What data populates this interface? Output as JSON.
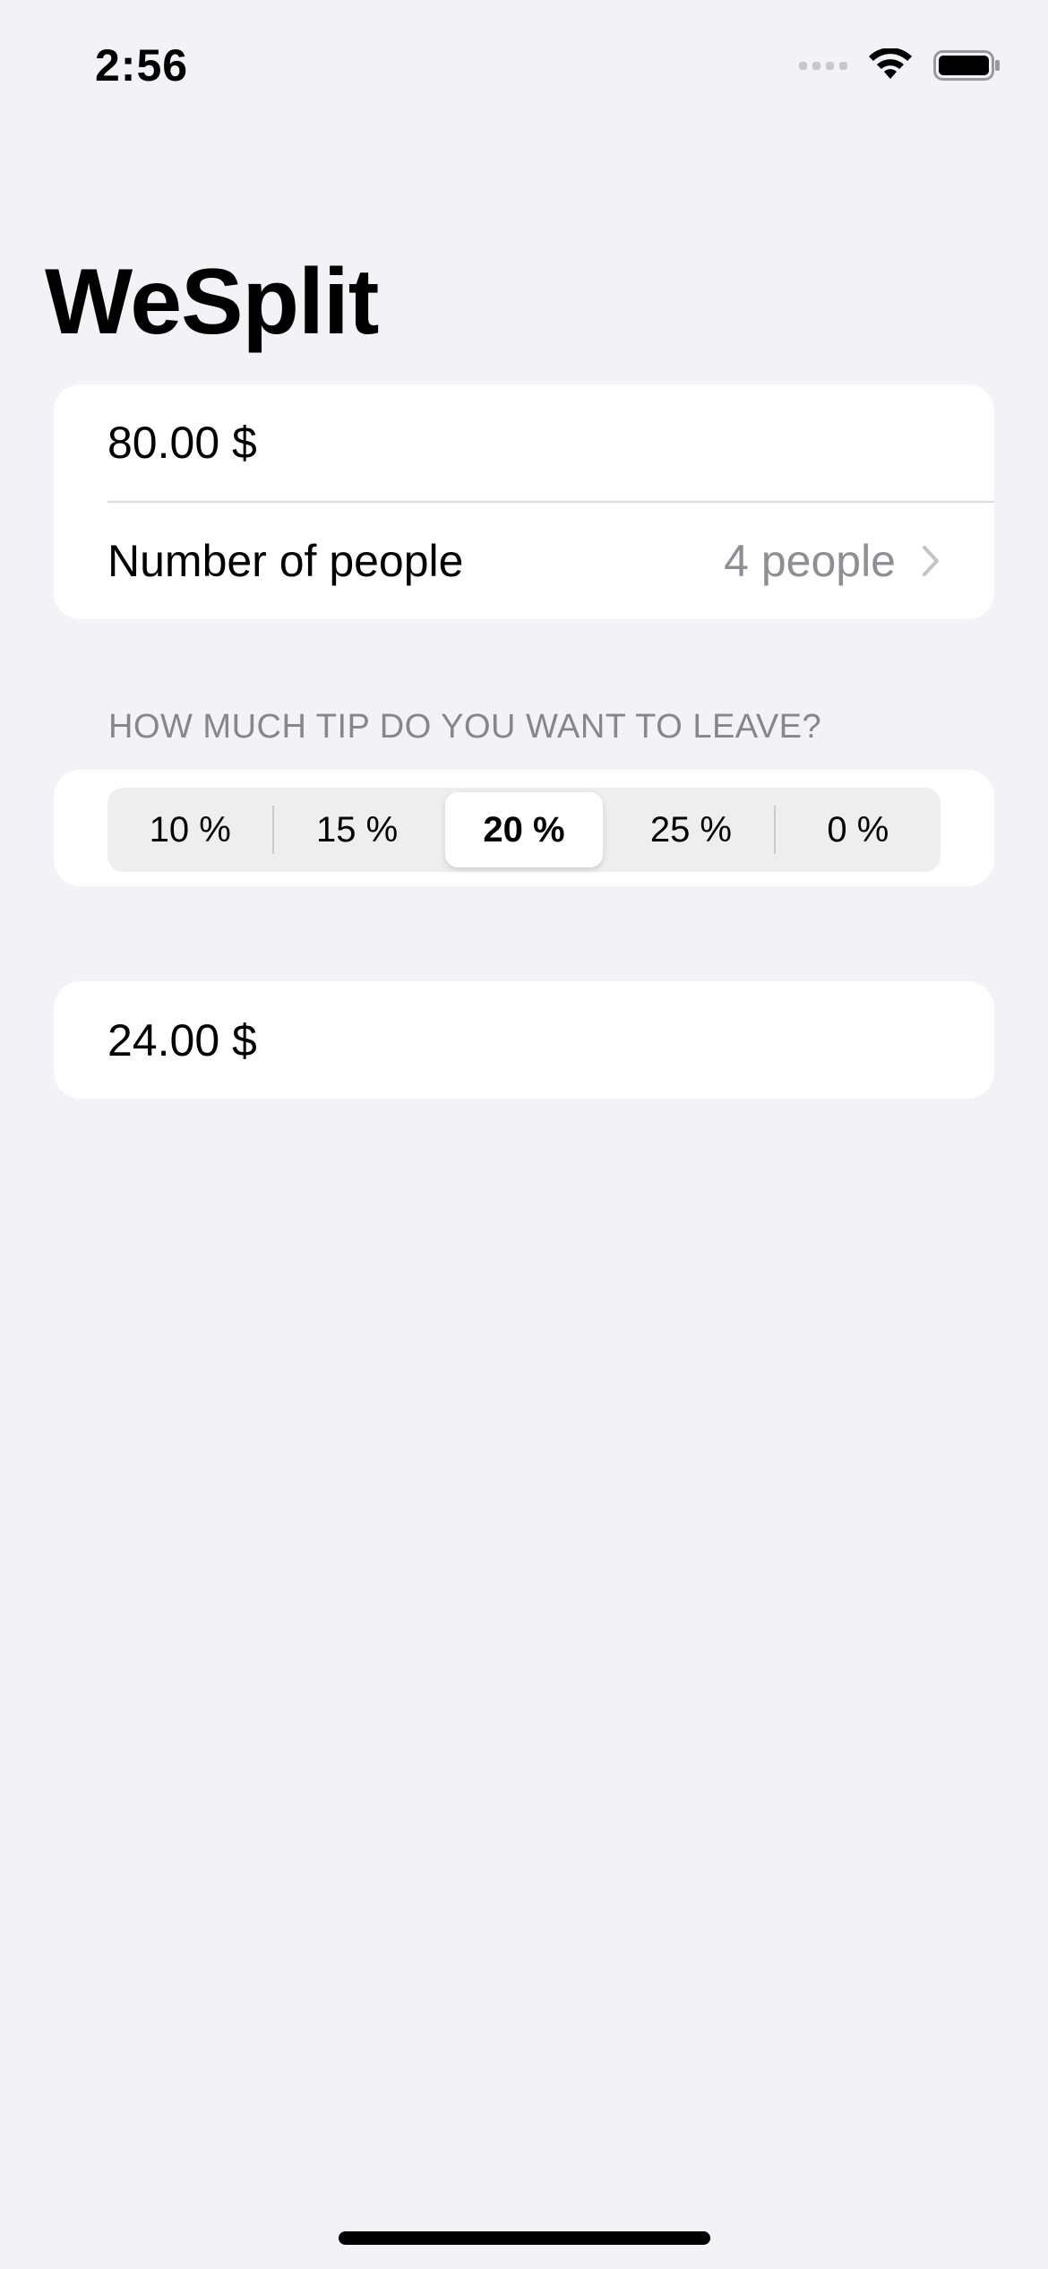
{
  "status_bar": {
    "time": "2:56",
    "icons": [
      "signal-dots",
      "wifi-icon",
      "battery-icon"
    ]
  },
  "nav": {
    "title": "WeSplit"
  },
  "form": {
    "check_amount": "80.00 $",
    "people_label": "Number of people",
    "people_value": "4 people",
    "people_icon": "chevron-right-icon"
  },
  "tip_section": {
    "header": "HOW MUCH TIP DO YOU WANT TO LEAVE?",
    "options": [
      "10 %",
      "15 %",
      "20 %",
      "25 %",
      "0 %"
    ],
    "selected": "20 %"
  },
  "total": {
    "amount_per_person": "24.00 $"
  },
  "colors": {
    "background": "#F2F2F7",
    "card": "#FFFFFF",
    "secondary_text": "#8E8E93",
    "segment_track": "#EEEEEF"
  }
}
